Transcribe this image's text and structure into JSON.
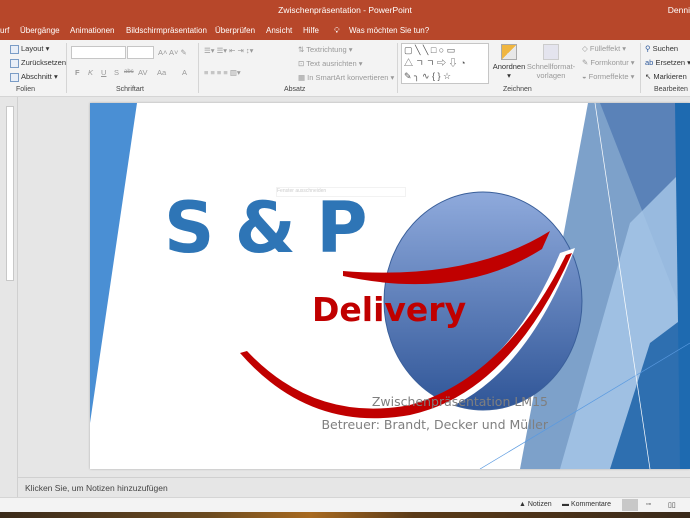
{
  "window": {
    "title": "Zwischenpräsentation  -  PowerPoint",
    "user": "Denni"
  },
  "tabs": [
    "urf",
    "Übergänge",
    "Animationen",
    "Bildschirmpräsentation",
    "Überprüfen",
    "Ansicht",
    "Hilfe"
  ],
  "tell_me": "Was möchten Sie tun?",
  "ribbon": {
    "folien": {
      "label": "Folien",
      "layout": "Layout",
      "reset": "Zurücksetzen",
      "section": "Abschnitt"
    },
    "schriftart": {
      "label": "Schriftart",
      "bold": "F",
      "italic": "K",
      "underline": "U",
      "strike": "S",
      "abc": "abc",
      "spacing": "AV",
      "case": "Aa",
      "color": "A"
    },
    "absatz": {
      "label": "Absatz",
      "direction": "Textrichtung",
      "align": "Text ausrichten",
      "smartart": "In SmartArt konvertieren"
    },
    "zeichnen": {
      "label": "Zeichnen",
      "arrange": "Anordnen",
      "quick_styles": "Schnellformat-vorlagen",
      "fill": "Fülleffekt",
      "outline": "Formkontur",
      "effects": "Formeffekte"
    },
    "bearbeiten": {
      "label": "Bearbeiten",
      "find": "Suchen",
      "replace": "Ersetzen",
      "select": "Markieren"
    }
  },
  "slide": {
    "logo_text": "S & P",
    "logo_sub": "Delivery",
    "faint_overlay": "Fenster ausschneiden",
    "subtitle_line1": "Zwischenpräsentation LM15",
    "subtitle_line2": "Betreuer: Brandt, Decker und Müller"
  },
  "notes_placeholder": "Klicken Sie, um Notizen hinzuzufügen",
  "status": {
    "notes": "Notizen",
    "comments": "Kommentare"
  },
  "colors": {
    "accent": "#b7472a",
    "logo_blue": "#2e75b6",
    "logo_red": "#c00000"
  }
}
